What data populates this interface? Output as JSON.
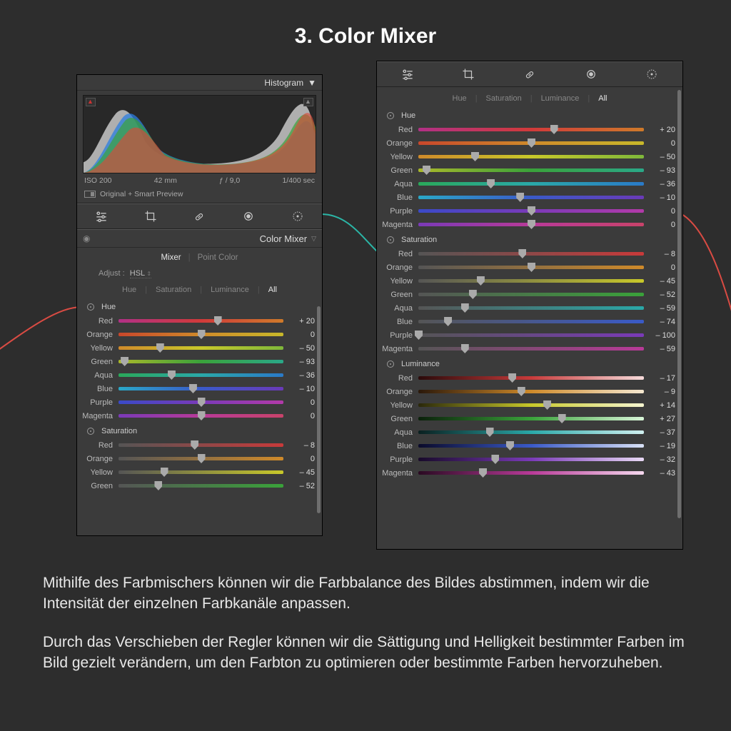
{
  "page_title": "3. Color Mixer",
  "histogram": {
    "title": "Histogram",
    "meta": {
      "iso": "ISO 200",
      "focal": "42 mm",
      "aperture": "ƒ / 9,0",
      "shutter": "1/400 sec"
    },
    "original_label": "Original + Smart Preview"
  },
  "section": {
    "title": "Color Mixer",
    "tabs": [
      "Mixer",
      "Point Color"
    ],
    "active_tab": "Mixer",
    "adjust_label": "Adjust :",
    "adjust_value": "HSL",
    "modes": [
      "Hue",
      "Saturation",
      "Luminance",
      "All"
    ],
    "active_mode": "All"
  },
  "groups": {
    "hue": {
      "title": "Hue",
      "rows": [
        {
          "label": "Red",
          "value": 20,
          "display": "+ 20",
          "grad": "g-hue-red"
        },
        {
          "label": "Orange",
          "value": 0,
          "display": "0",
          "grad": "g-hue-orange"
        },
        {
          "label": "Yellow",
          "value": -50,
          "display": "– 50",
          "grad": "g-hue-yellow"
        },
        {
          "label": "Green",
          "value": -93,
          "display": "– 93",
          "grad": "g-hue-green"
        },
        {
          "label": "Aqua",
          "value": -36,
          "display": "– 36",
          "grad": "g-hue-aqua"
        },
        {
          "label": "Blue",
          "value": -10,
          "display": "– 10",
          "grad": "g-hue-blue"
        },
        {
          "label": "Purple",
          "value": 0,
          "display": "0",
          "grad": "g-hue-purple"
        },
        {
          "label": "Magenta",
          "value": 0,
          "display": "0",
          "grad": "g-hue-magenta"
        }
      ]
    },
    "saturation": {
      "title": "Saturation",
      "rows": [
        {
          "label": "Red",
          "value": -8,
          "display": "– 8",
          "grad": "g-sat-red"
        },
        {
          "label": "Orange",
          "value": 0,
          "display": "0",
          "grad": "g-sat-orange"
        },
        {
          "label": "Yellow",
          "value": -45,
          "display": "– 45",
          "grad": "g-sat-yellow"
        },
        {
          "label": "Green",
          "value": -52,
          "display": "– 52",
          "grad": "g-sat-green"
        },
        {
          "label": "Aqua",
          "value": -59,
          "display": "– 59",
          "grad": "g-sat-aqua"
        },
        {
          "label": "Blue",
          "value": -74,
          "display": "– 74",
          "grad": "g-sat-blue"
        },
        {
          "label": "Purple",
          "value": -100,
          "display": "– 100",
          "grad": "g-sat-purple"
        },
        {
          "label": "Magenta",
          "value": -59,
          "display": "– 59",
          "grad": "g-sat-magenta"
        }
      ]
    },
    "luminance": {
      "title": "Luminance",
      "rows": [
        {
          "label": "Red",
          "value": -17,
          "display": "– 17",
          "grad": "g-lum-red"
        },
        {
          "label": "Orange",
          "value": -9,
          "display": "– 9",
          "grad": "g-lum-orange"
        },
        {
          "label": "Yellow",
          "value": 14,
          "display": "+ 14",
          "grad": "g-lum-yellow"
        },
        {
          "label": "Green",
          "value": 27,
          "display": "+ 27",
          "grad": "g-lum-green"
        },
        {
          "label": "Aqua",
          "value": -37,
          "display": "– 37",
          "grad": "g-lum-aqua"
        },
        {
          "label": "Blue",
          "value": -19,
          "display": "– 19",
          "grad": "g-lum-blue"
        },
        {
          "label": "Purple",
          "value": -32,
          "display": "– 32",
          "grad": "g-lum-purple"
        },
        {
          "label": "Magenta",
          "value": -43,
          "display": "– 43",
          "grad": "g-lum-magenta"
        }
      ]
    }
  },
  "left_sat_visible": [
    "Red",
    "Orange",
    "Yellow",
    "Green"
  ],
  "body": {
    "p1": "Mithilfe des Farbmischers können wir die Farbbalance des Bildes abstimmen, indem wir die Intensität der einzelnen Farbkanäle anpassen.",
    "p2": "Durch das Verschieben der Regler können wir die Sättigung und Helligkeit bestimmter Farben im Bild gezielt verändern, um den Farbton zu optimieren oder bestimmte Farben hervorzuheben."
  }
}
